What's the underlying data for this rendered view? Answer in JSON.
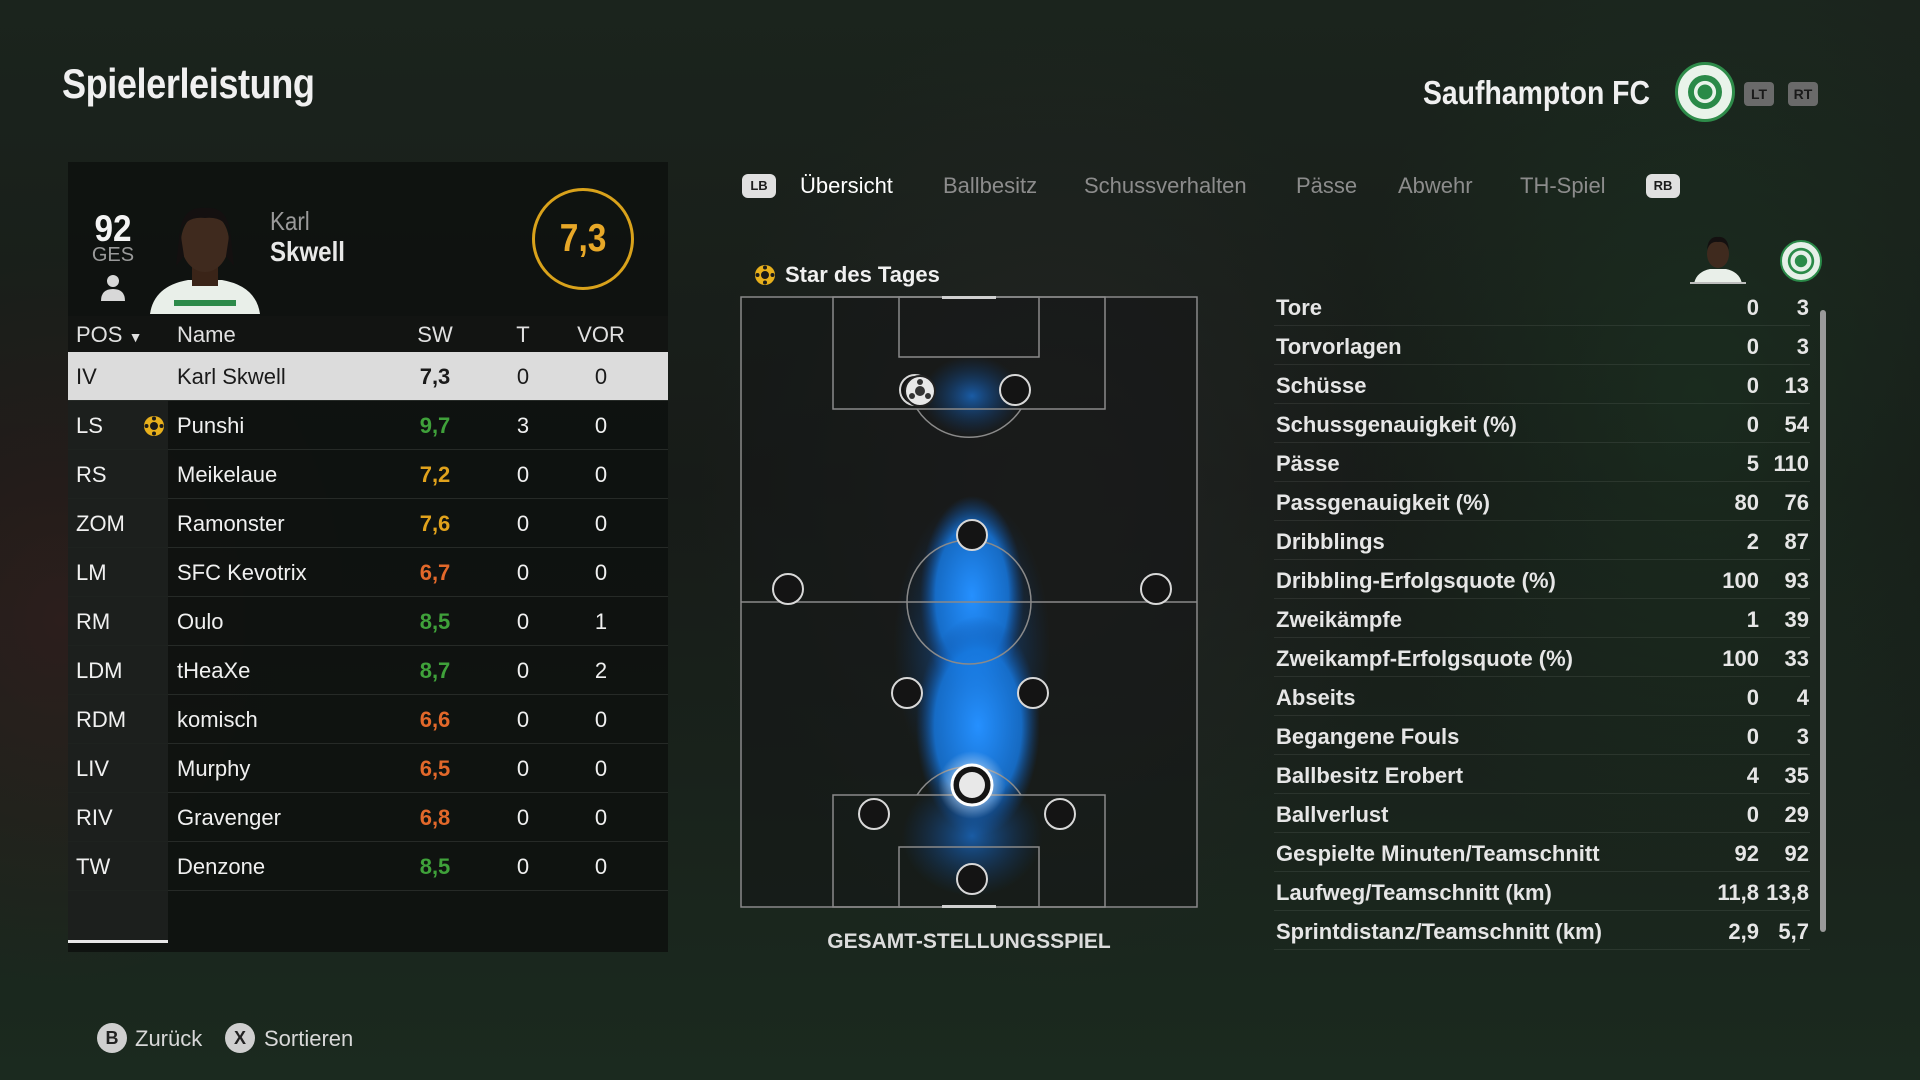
{
  "header": {
    "title": "Spielerleistung",
    "club_name": "Saufhampton FC",
    "lt_label": "LT",
    "rt_label": "RT"
  },
  "player": {
    "overall": "92",
    "overall_label": "GES",
    "first_name": "Karl",
    "last_name": "Skwell",
    "match_rating": "7,3"
  },
  "table": {
    "headers": {
      "pos": "POS",
      "name": "Name",
      "sw": "SW",
      "t": "T",
      "vor": "VOR"
    },
    "rows": [
      {
        "pos": "IV",
        "name": "Karl Skwell",
        "sw": "7,3",
        "t": "0",
        "vor": "0",
        "sw_color": "#1a1a1a",
        "selected": true,
        "star": false
      },
      {
        "pos": "LS",
        "name": "Punshi",
        "sw": "9,7",
        "t": "3",
        "vor": "0",
        "sw_color": "#3fa13a",
        "selected": false,
        "star": true
      },
      {
        "pos": "RS",
        "name": "Meikelaue",
        "sw": "7,2",
        "t": "0",
        "vor": "0",
        "sw_color": "#e0a21c",
        "selected": false,
        "star": false
      },
      {
        "pos": "ZOM",
        "name": "Ramonster",
        "sw": "7,6",
        "t": "0",
        "vor": "0",
        "sw_color": "#e0a21c",
        "selected": false,
        "star": false
      },
      {
        "pos": "LM",
        "name": "SFC Kevotrix",
        "sw": "6,7",
        "t": "0",
        "vor": "0",
        "sw_color": "#e2682a",
        "selected": false,
        "star": false
      },
      {
        "pos": "RM",
        "name": "Oulo",
        "sw": "8,5",
        "t": "0",
        "vor": "1",
        "sw_color": "#3fa13a",
        "selected": false,
        "star": false
      },
      {
        "pos": "LDM",
        "name": "tHeaXe",
        "sw": "8,7",
        "t": "0",
        "vor": "2",
        "sw_color": "#3fa13a",
        "selected": false,
        "star": false
      },
      {
        "pos": "RDM",
        "name": "komisch",
        "sw": "6,6",
        "t": "0",
        "vor": "0",
        "sw_color": "#e2682a",
        "selected": false,
        "star": false
      },
      {
        "pos": "LIV",
        "name": "Murphy",
        "sw": "6,5",
        "t": "0",
        "vor": "0",
        "sw_color": "#e2682a",
        "selected": false,
        "star": false
      },
      {
        "pos": "RIV",
        "name": "Gravenger",
        "sw": "6,8",
        "t": "0",
        "vor": "0",
        "sw_color": "#e2682a",
        "selected": false,
        "star": false
      },
      {
        "pos": "TW",
        "name": "Denzone",
        "sw": "8,5",
        "t": "0",
        "vor": "0",
        "sw_color": "#3fa13a",
        "selected": false,
        "star": false
      }
    ]
  },
  "tabs": {
    "lb": "LB",
    "rb": "RB",
    "items": [
      "Übersicht",
      "Ballbesitz",
      "Schussverhalten",
      "Pässe",
      "Abwehr",
      "TH-Spiel"
    ],
    "active_index": 0
  },
  "star_of_day": "Star des Tages",
  "pitch_caption": "GESAMT-STELLUNGSSPIEL",
  "stats": [
    {
      "label": "Tore",
      "player": "0",
      "team": "3"
    },
    {
      "label": "Torvorlagen",
      "player": "0",
      "team": "3"
    },
    {
      "label": "Schüsse",
      "player": "0",
      "team": "13"
    },
    {
      "label": "Schussgenauigkeit (%)",
      "player": "0",
      "team": "54"
    },
    {
      "label": "Pässe",
      "player": "5",
      "team": "110"
    },
    {
      "label": "Passgenauigkeit (%)",
      "player": "80",
      "team": "76"
    },
    {
      "label": "Dribblings",
      "player": "2",
      "team": "87"
    },
    {
      "label": "Dribbling-Erfolgsquote (%)",
      "player": "100",
      "team": "93"
    },
    {
      "label": "Zweikämpfe",
      "player": "1",
      "team": "39"
    },
    {
      "label": "Zweikampf-Erfolgsquote (%)",
      "player": "100",
      "team": "33"
    },
    {
      "label": "Abseits",
      "player": "0",
      "team": "4"
    },
    {
      "label": "Begangene Fouls",
      "player": "0",
      "team": "3"
    },
    {
      "label": "Ballbesitz Erobert",
      "player": "4",
      "team": "35"
    },
    {
      "label": "Ballverlust",
      "player": "0",
      "team": "29"
    },
    {
      "label": "Gespielte Minuten/Teamschnitt",
      "player": "92",
      "team": "92"
    },
    {
      "label": "Laufweg/Teamschnitt (km)",
      "player": "11,8",
      "team": "13,8"
    },
    {
      "label": "Sprintdistanz/Teamschnitt (km)",
      "player": "2,9",
      "team": "5,7"
    }
  ],
  "footer": {
    "back_key": "B",
    "back_label": "Zurück",
    "sort_key": "X",
    "sort_label": "Sortieren"
  },
  "colors": {
    "accent_gold": "#d9a21b",
    "good_green": "#3fa13a",
    "mid_orange": "#e0a21c",
    "low_orange": "#e2682a",
    "heatmap_blue": "#1e7fe0"
  }
}
